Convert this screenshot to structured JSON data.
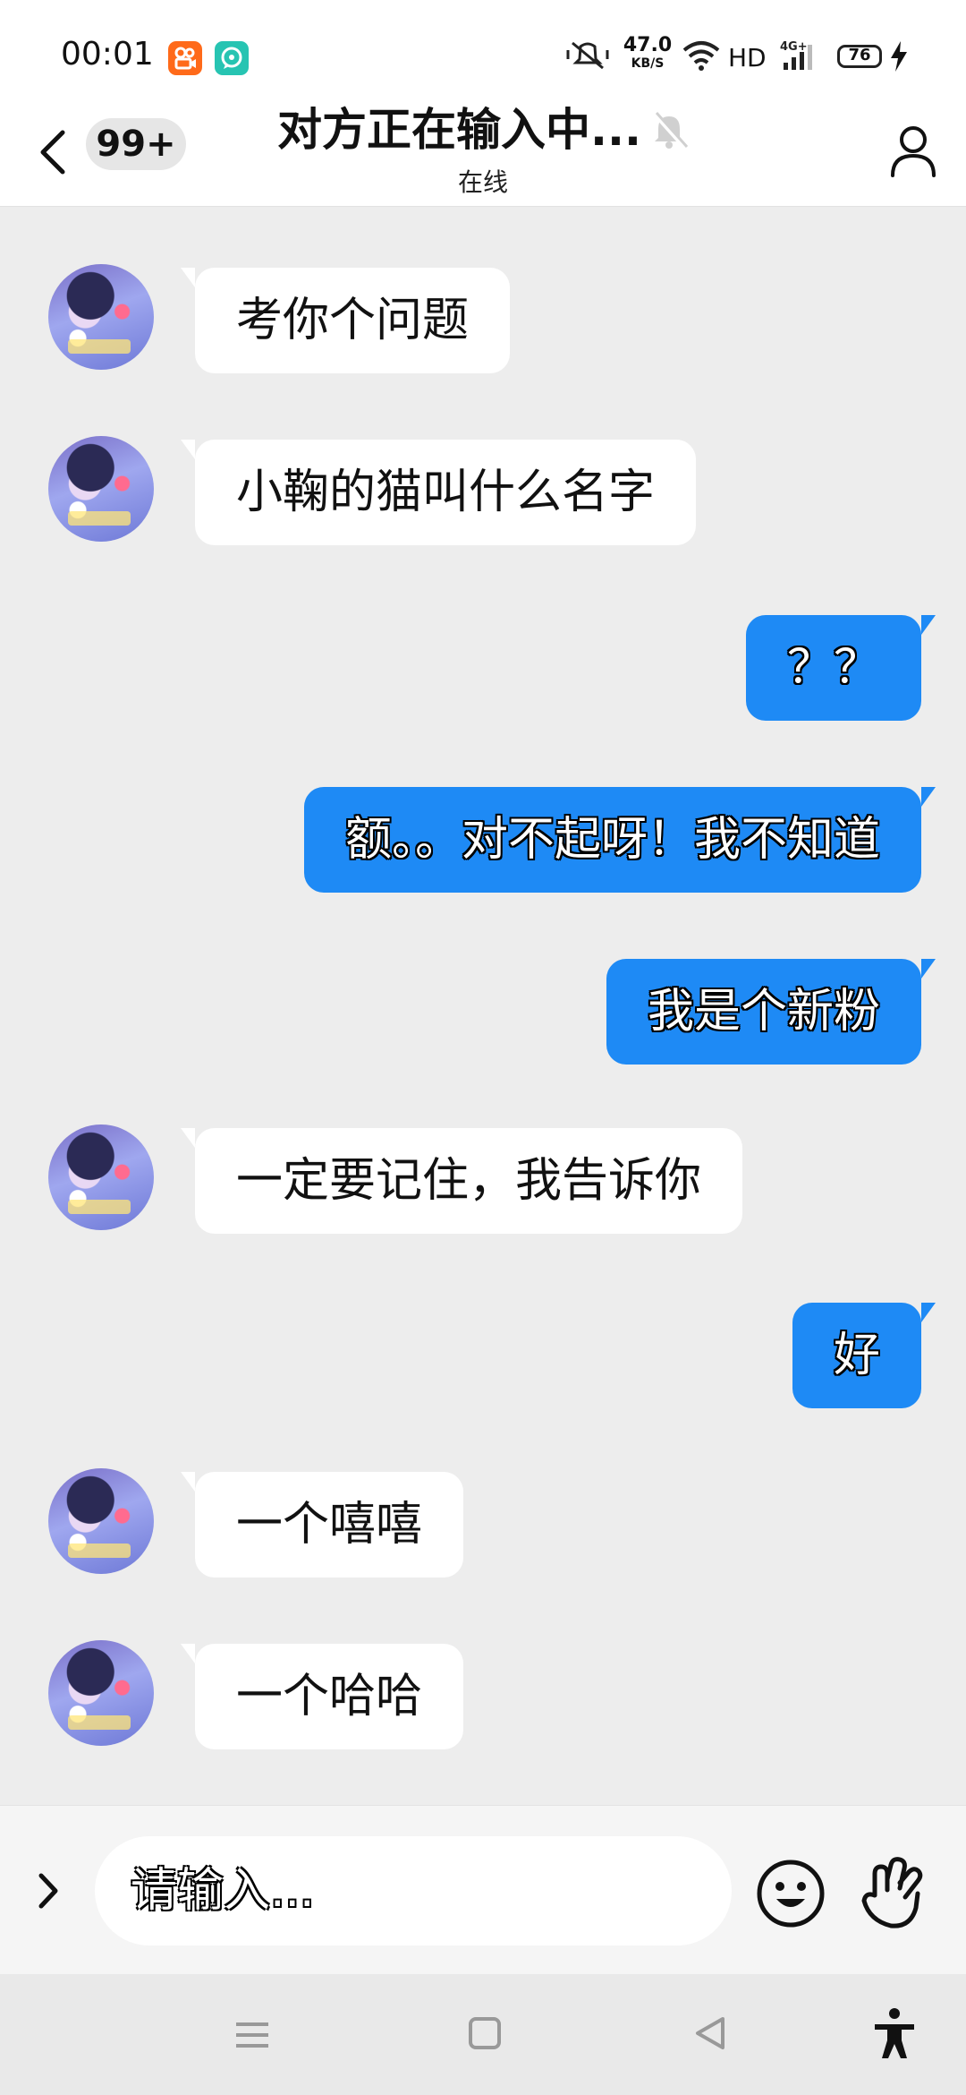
{
  "status_bar": {
    "time": "00:01",
    "app_icons": [
      "kuaishou-icon",
      "chat-app-icon"
    ],
    "net_speed_value": "47.0",
    "net_speed_unit": "KB/S",
    "hd": "HD",
    "network": "4G+",
    "battery": "76",
    "charging": true
  },
  "header": {
    "back_icon": "chevron-left-icon",
    "unread_badge": "99+",
    "title": "对方正在输入中...",
    "muted_icon": "bell-muted-icon",
    "subtitle": "在线",
    "profile_icon": "person-icon"
  },
  "colors": {
    "outgoing_bubble": "#1e8af5",
    "incoming_bubble": "#ffffff",
    "chat_background": "#ededed"
  },
  "messages": [
    {
      "direction": "incoming",
      "text": "考你个问题"
    },
    {
      "direction": "incoming",
      "text": "小鞠的猫叫什么名字"
    },
    {
      "direction": "outgoing",
      "text": "？？"
    },
    {
      "direction": "outgoing",
      "text": "额。。对不起呀！我不知道"
    },
    {
      "direction": "outgoing",
      "text": "我是个新粉"
    },
    {
      "direction": "incoming",
      "text": "一定要记住，我告诉你"
    },
    {
      "direction": "outgoing",
      "text": "好"
    },
    {
      "direction": "incoming",
      "text": "一个嘻嘻"
    },
    {
      "direction": "incoming",
      "text": "一个哈哈"
    }
  ],
  "input": {
    "placeholder": "请输入...",
    "value": "",
    "expand_icon": "chevron-right-icon",
    "emoji_icon": "smiley-icon",
    "gesture_icon": "hand-gesture-icon"
  },
  "nav_bar": {
    "icons": [
      "menu-icon",
      "home-square-icon",
      "back-triangle-icon",
      "accessibility-icon"
    ]
  }
}
